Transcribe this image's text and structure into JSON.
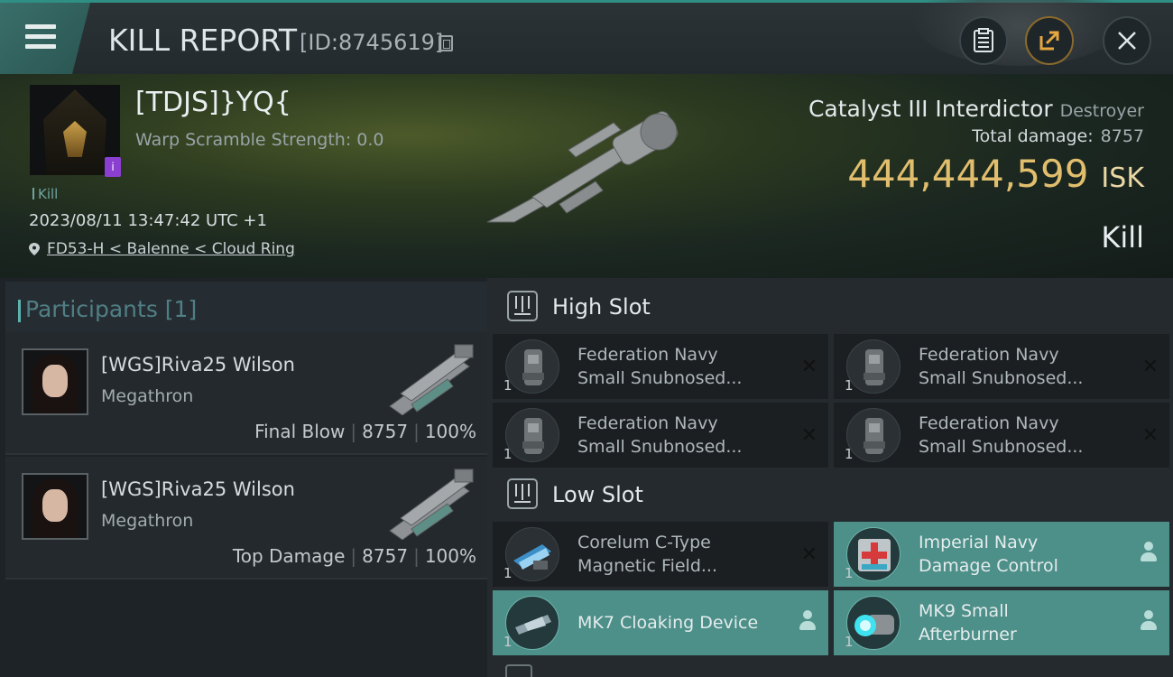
{
  "header": {
    "title": "KILL REPORT",
    "report_id": "[ID:8745619]"
  },
  "victim": {
    "name": "[TDJS]}YQ{",
    "warp_scramble": "Warp Scramble Strength: 0.0",
    "kill_tag": "Kill",
    "datetime": "2023/08/11 13:47:42 UTC +1",
    "location": "FD53-H < Balenne < Cloud Ring",
    "badge": "i"
  },
  "ship": {
    "name": "Catalyst III Interdictor",
    "class": "Destroyer",
    "total_damage_label": "Total damage:",
    "total_damage": "8757",
    "isk_value": "444,444,599",
    "isk_unit": "ISK",
    "result": "Kill"
  },
  "participants": {
    "title": "Participants [1]",
    "rows": [
      {
        "name": "[WGS]Riva25 Wilson",
        "ship": "Megathron",
        "role": "Final Blow",
        "damage": "8757",
        "percent": "100%"
      },
      {
        "name": "[WGS]Riva25 Wilson",
        "ship": "Megathron",
        "role": "Top Damage",
        "damage": "8757",
        "percent": "100%"
      }
    ]
  },
  "slots": {
    "high": {
      "label": "High Slot",
      "modules": [
        {
          "name1": "Federation Navy",
          "name2": "Small Snubnosed...",
          "qty": "1"
        },
        {
          "name1": "Federation Navy",
          "name2": "Small Snubnosed...",
          "qty": "1"
        },
        {
          "name1": "Federation Navy",
          "name2": "Small Snubnosed...",
          "qty": "1"
        },
        {
          "name1": "Federation Navy",
          "name2": "Small Snubnosed...",
          "qty": "1"
        }
      ]
    },
    "low": {
      "label": "Low Slot",
      "modules": [
        {
          "name1": "Corelum C-Type",
          "name2": "Magnetic Field...",
          "qty": "1"
        },
        {
          "name1": "Imperial Navy",
          "name2": "Damage Control",
          "qty": "1"
        },
        {
          "name1": "MK7 Cloaking Device",
          "name2": "",
          "qty": "1"
        },
        {
          "name1": "MK9 Small",
          "name2": "Afterburner",
          "qty": "1"
        }
      ]
    }
  },
  "colors": {
    "accent": "#2f8f85",
    "isk": "#e0be6d",
    "active_module": "#4d8f89"
  }
}
